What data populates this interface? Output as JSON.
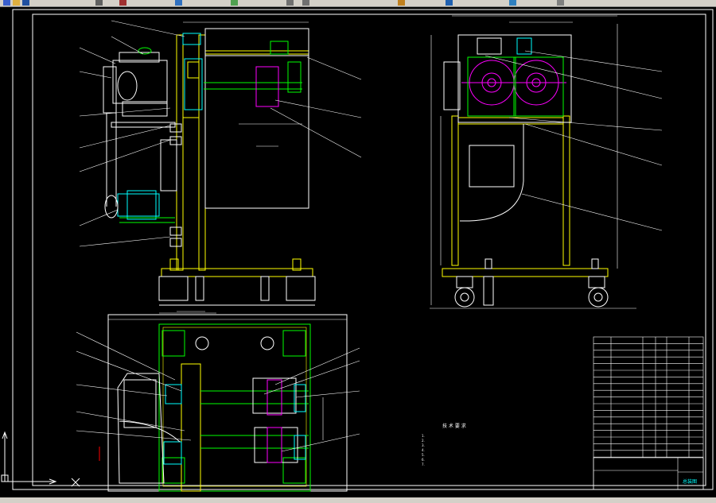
{
  "app": {
    "toolbar_title": "",
    "status_text": ""
  },
  "toolbar": {
    "icons": [
      "new-file-icon",
      "open-icon",
      "save-icon",
      "print-icon",
      "cut-icon",
      "copy-icon",
      "paste-icon",
      "undo-icon",
      "redo-icon",
      "pan-icon",
      "zoom-icon",
      "layer-icon",
      "properties-icon"
    ]
  },
  "drawing": {
    "tech_requirements_title": "技 术 要 求",
    "tech_requirements": [
      "1. ",
      "2. ",
      "3. ",
      "4. ",
      "5. ",
      "6. ",
      "7. "
    ],
    "title_block": {
      "name": "",
      "drawing_type": "总装图"
    },
    "colors": {
      "frame": "#ffffff",
      "body": "#ffff00",
      "outline": "#00ff00",
      "roller": "#ff00ff",
      "cyan": "#00ffff",
      "red": "#ff0000"
    }
  }
}
